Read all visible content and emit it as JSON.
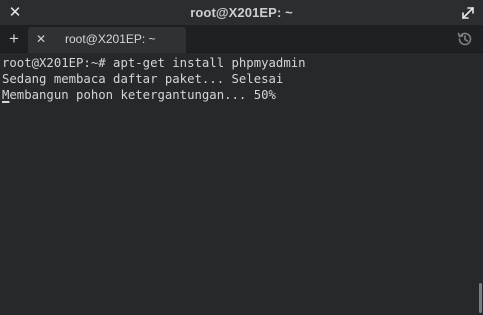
{
  "window": {
    "title": "root@X201EP: ~",
    "close_icon": "close-icon",
    "maximize_icon": "maximize-icon"
  },
  "tabs": {
    "new_tab_icon": "plus-icon",
    "new_tab_glyph": "+",
    "items": [
      {
        "label": "root@X201EP: ~",
        "close_glyph": "✕"
      }
    ],
    "history_icon": "history-icon"
  },
  "terminal": {
    "lines": [
      "root@X201EP:~# apt-get install phpmyadmin",
      "Sedang membaca daftar paket... Selesai",
      "Membangun pohon ketergantungan... 50%"
    ],
    "text_color": "#d5d5d5",
    "background": "#26292c"
  }
}
